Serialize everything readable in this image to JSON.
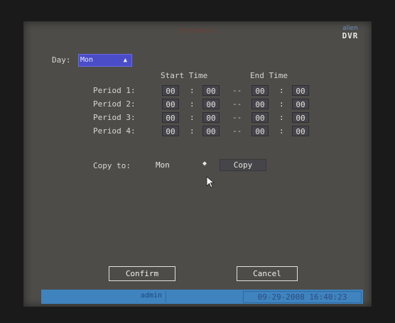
{
  "window": {
    "title": "Schedule"
  },
  "logo": {
    "line1": "alien",
    "line2": "DVR"
  },
  "day": {
    "label": "Day:",
    "value": "Mon"
  },
  "headers": {
    "start": "Start Time",
    "end": "End Time"
  },
  "periods": [
    {
      "label": "Period 1:",
      "start_h": "00",
      "start_m": "00",
      "end_h": "00",
      "end_m": "00"
    },
    {
      "label": "Period 2:",
      "start_h": "00",
      "start_m": "00",
      "end_h": "00",
      "end_m": "00"
    },
    {
      "label": "Period 3:",
      "start_h": "00",
      "start_m": "00",
      "end_h": "00",
      "end_m": "00"
    },
    {
      "label": "Period 4:",
      "start_h": "00",
      "start_m": "00",
      "end_h": "00",
      "end_m": "00"
    }
  ],
  "separators": {
    "colon": ":",
    "dash": "--"
  },
  "copy": {
    "label": "Copy to:",
    "value": "Mon",
    "button": "Copy"
  },
  "buttons": {
    "confirm": "Confirm",
    "cancel": "Cancel"
  },
  "status": {
    "user": "admin",
    "datetime": "09-29-2008 16:40:23"
  },
  "icons": {
    "select_arrow": "up-down-arrow-icon",
    "pointer": "mouse-pointer-icon"
  }
}
